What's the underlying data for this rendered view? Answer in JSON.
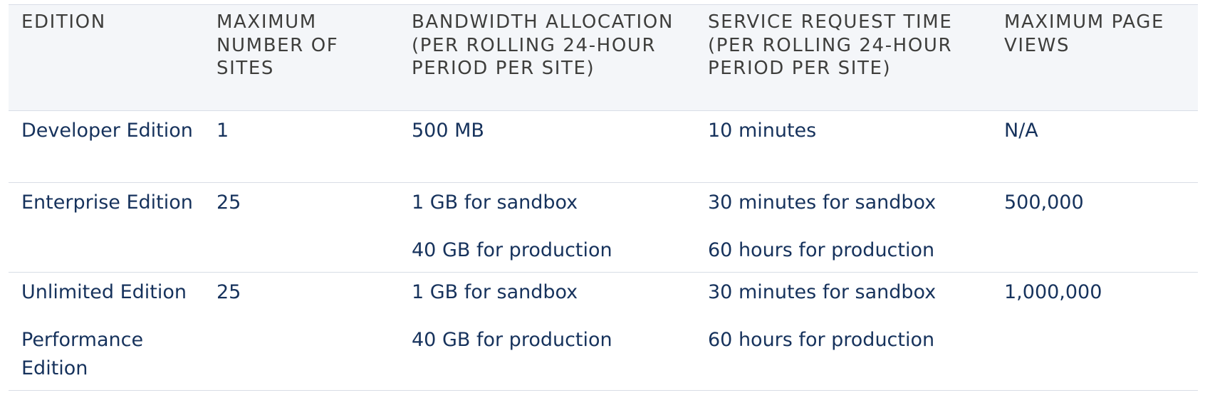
{
  "table": {
    "headers": [
      "EDITION",
      "MAXIMUM NUMBER OF SITES",
      "BANDWIDTH ALLOCATION (PER ROLLING 24-HOUR PERIOD PER SITE)",
      "SERVICE REQUEST TIME (PER ROLLING 24-HOUR PERIOD PER SITE)",
      "MAXIMUM PAGE VIEWS"
    ],
    "rows": [
      {
        "edition": [
          "Developer Edition"
        ],
        "max_sites": "1",
        "bandwidth": [
          "500 MB"
        ],
        "service_time": [
          "10 minutes"
        ],
        "page_views": "N/A"
      },
      {
        "edition": [
          "Enterprise Edition"
        ],
        "max_sites": "25",
        "bandwidth": [
          "1 GB for sandbox",
          "40 GB for production"
        ],
        "service_time": [
          "30 minutes for sandbox",
          "60 hours for production"
        ],
        "page_views": "500,000"
      },
      {
        "edition": [
          "Unlimited Edition",
          "Performance Edition"
        ],
        "max_sites": "25",
        "bandwidth": [
          "1 GB for sandbox",
          "40 GB for production"
        ],
        "service_time": [
          "30 minutes for sandbox",
          "60 hours for production"
        ],
        "page_views": "1,000,000"
      }
    ]
  }
}
